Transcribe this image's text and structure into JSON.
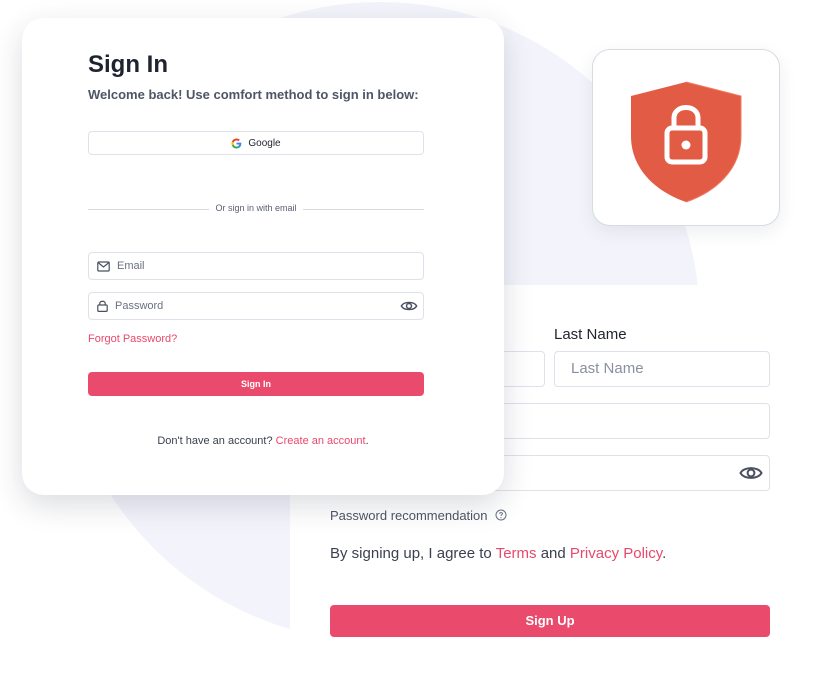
{
  "signin": {
    "title": "Sign In",
    "subtitle": "Welcome back! Use comfort method to sign in below:",
    "google_label": "Google",
    "divider_text": "Or sign in with email",
    "email_placeholder": "Email",
    "password_placeholder": "Password",
    "forgot_label": "Forgot Password?",
    "button_label": "Sign In",
    "account_prompt": "Don't have an account?",
    "create_account_link": "Create an account",
    "create_account_suffix": "."
  },
  "signup": {
    "last_name_label": "Last Name",
    "last_name_placeholder": "Last Name",
    "password_hint": "Password recommendation",
    "agree_prefix": "By signing up, I agree to",
    "terms_link": "Terms",
    "and_text": "and",
    "privacy_link": "Privacy Policy",
    "agree_suffix": ".",
    "button_label": "Sign Up"
  },
  "icons": {
    "shield": "shield-lock-icon",
    "google": "google-icon",
    "mail": "mail-icon",
    "lock": "lock-icon",
    "eye": "eye-icon",
    "help": "help-circle-icon"
  },
  "colors": {
    "accent": "#ea4a6c",
    "shield": "#e25c45",
    "background_circle": "#f3f4fb"
  }
}
